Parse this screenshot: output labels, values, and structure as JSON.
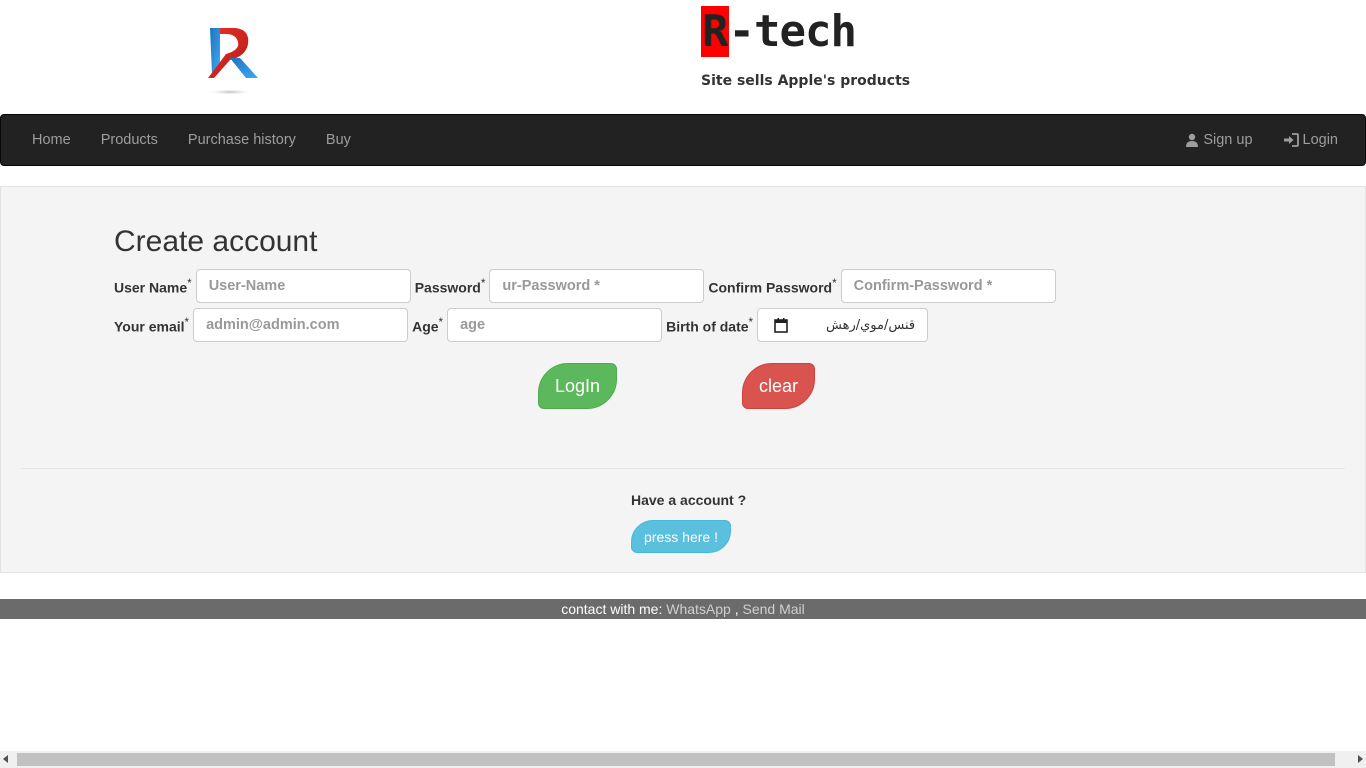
{
  "header": {
    "brand_initial": "R",
    "brand_rest": "-tech",
    "subtitle": "Site sells Apple's products"
  },
  "nav": {
    "left": [
      {
        "label": "Home"
      },
      {
        "label": "Products"
      },
      {
        "label": "Purchase history"
      },
      {
        "label": "Buy"
      }
    ],
    "signup": {
      "label": "Sign up",
      "icon": "user-icon"
    },
    "login": {
      "label": "Login",
      "icon": "login-icon"
    }
  },
  "form": {
    "title": "Create account",
    "required_mark": "*",
    "username": {
      "label": "User Name",
      "placeholder": "User-Name"
    },
    "password": {
      "label": "Password",
      "placeholder": "ur-Password *"
    },
    "confirm_password": {
      "label": "Confirm Password",
      "placeholder": "Confirm-Password *"
    },
    "email": {
      "label": "Your email",
      "placeholder": "admin@admin.com"
    },
    "age": {
      "label": "Age",
      "placeholder": "age"
    },
    "birth": {
      "label": "Birth of date",
      "value": "قنس/موي/رهش",
      "icon": "calendar-icon"
    },
    "login_button": "LogIn",
    "clear_button": "clear",
    "have_account": "Have a account ?",
    "press_here": "press here !"
  },
  "footer": {
    "prefix": "contact with me:",
    "whatsapp": "WhatsApp",
    "separator": ",",
    "mail": "Send Mail"
  },
  "colors": {
    "navbar": "#222222",
    "success": "#5cb85c",
    "danger": "#d9534f",
    "info": "#5bc0de",
    "brand_red": "#ff0000"
  }
}
